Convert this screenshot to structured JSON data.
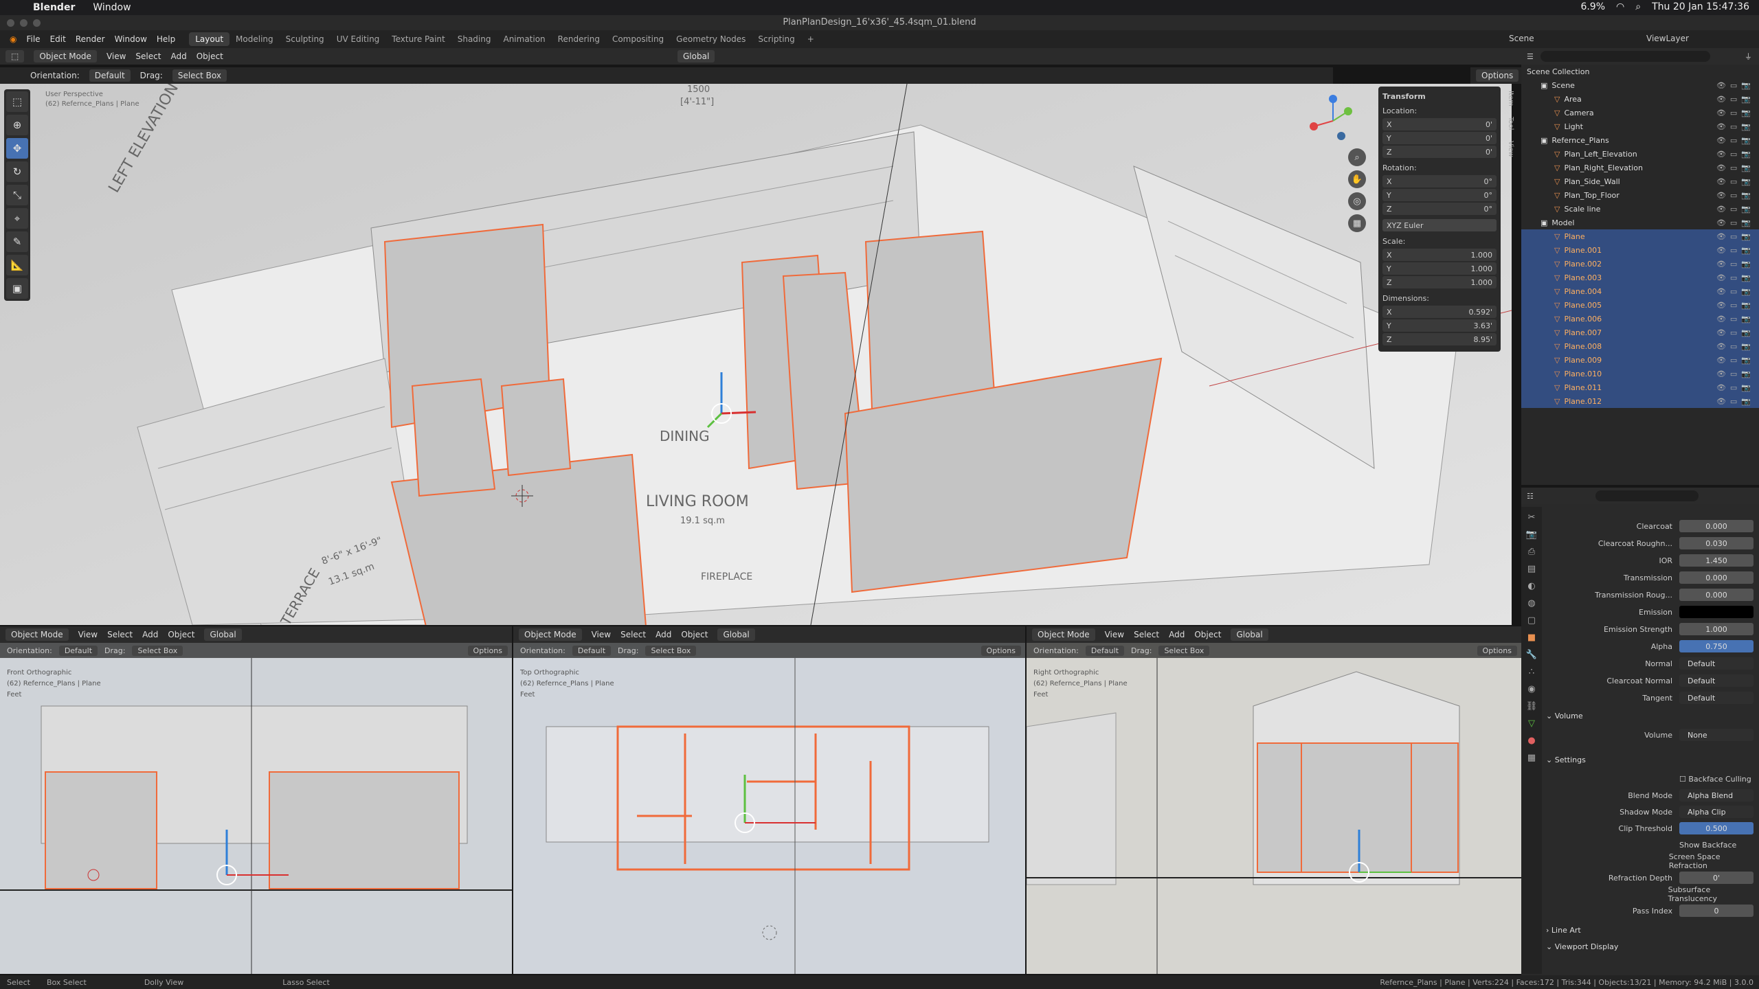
{
  "macbar": {
    "app": "Blender",
    "menu": [
      "Window"
    ],
    "battery": "6.9%",
    "datetime": "Thu 20 Jan  15:47:36"
  },
  "window": {
    "title": "PlanPlanDesign_16'x36'_45.4sqm_01.blend"
  },
  "menus": [
    "File",
    "Edit",
    "Render",
    "Window",
    "Help"
  ],
  "workspaces": [
    "Layout",
    "Modeling",
    "Sculpting",
    "UV Editing",
    "Texture Paint",
    "Shading",
    "Animation",
    "Rendering",
    "Compositing",
    "Geometry Nodes",
    "Scripting"
  ],
  "scene": {
    "name": "Scene",
    "view_layer": "ViewLayer"
  },
  "header": {
    "mode": "Object Mode",
    "view": "View",
    "select": "Select",
    "add": "Add",
    "object": "Object",
    "transform": "Global",
    "orientation_label": "Orientation:",
    "orientation": "Default",
    "drag_label": "Drag:",
    "drag": "Select Box",
    "options": "Options"
  },
  "viewport_main": {
    "view_name": "User Perspective",
    "collection": "(62) Refernce_Plans | Plane"
  },
  "drawing_labels": {
    "dining": "DINING",
    "living": "LIVING ROOM",
    "living_sub": "19.1 sq.m",
    "fireplace": "FIREPLACE",
    "terrace": "TERRACE",
    "terrace_dim": "8'-6\" x 16'-9\"",
    "terrace_area": "13.1 sq.m",
    "dim_top": "1500",
    "dim_top_imp": "[4'-11\"]",
    "elevation": "LEFT ELEVATION"
  },
  "transform": {
    "title": "Transform",
    "location_label": "Location:",
    "rotation_label": "Rotation:",
    "scale_label": "Scale:",
    "dimensions_label": "Dimensions:",
    "euler": "XYZ Euler",
    "location": [
      {
        "axis": "X",
        "value": "0'"
      },
      {
        "axis": "Y",
        "value": "0'"
      },
      {
        "axis": "Z",
        "value": "0'"
      }
    ],
    "rotation": [
      {
        "axis": "X",
        "value": "0°"
      },
      {
        "axis": "Y",
        "value": "0°"
      },
      {
        "axis": "Z",
        "value": "0°"
      }
    ],
    "scale": [
      {
        "axis": "X",
        "value": "1.000"
      },
      {
        "axis": "Y",
        "value": "1.000"
      },
      {
        "axis": "Z",
        "value": "1.000"
      }
    ],
    "dimensions": [
      {
        "axis": "X",
        "value": "0.592'"
      },
      {
        "axis": "Y",
        "value": "3.63'"
      },
      {
        "axis": "Z",
        "value": "8.95'"
      }
    ]
  },
  "side_tabs": [
    "Item",
    "Tool",
    "View"
  ],
  "bottom_views": [
    {
      "view_name": "Front Orthographic",
      "collection": "(62) Refernce_Plans | Plane",
      "units": "Feet"
    },
    {
      "view_name": "Top Orthographic",
      "collection": "(62) Refernce_Plans | Plane",
      "units": "Feet"
    },
    {
      "view_name": "Right Orthographic",
      "collection": "(62) Refernce_Plans | Plane",
      "units": "Feet"
    }
  ],
  "outliner": {
    "root": "Scene Collection",
    "items": [
      {
        "name": "Scene",
        "indent": 1,
        "sel": false
      },
      {
        "name": "Area",
        "indent": 2,
        "sel": false
      },
      {
        "name": "Camera",
        "indent": 2,
        "sel": false
      },
      {
        "name": "Light",
        "indent": 2,
        "sel": false
      },
      {
        "name": "Refernce_Plans",
        "indent": 1,
        "sel": false
      },
      {
        "name": "Plan_Left_Elevation",
        "indent": 2,
        "sel": false
      },
      {
        "name": "Plan_Right_Elevation",
        "indent": 2,
        "sel": false
      },
      {
        "name": "Plan_Side_Wall",
        "indent": 2,
        "sel": false
      },
      {
        "name": "Plan_Top_Floor",
        "indent": 2,
        "sel": false
      },
      {
        "name": "Scale line",
        "indent": 2,
        "sel": false
      },
      {
        "name": "Model",
        "indent": 1,
        "sel": false
      },
      {
        "name": "Plane",
        "indent": 2,
        "sel": true
      },
      {
        "name": "Plane.001",
        "indent": 2,
        "sel": true
      },
      {
        "name": "Plane.002",
        "indent": 2,
        "sel": true
      },
      {
        "name": "Plane.003",
        "indent": 2,
        "sel": true
      },
      {
        "name": "Plane.004",
        "indent": 2,
        "sel": true
      },
      {
        "name": "Plane.005",
        "indent": 2,
        "sel": true
      },
      {
        "name": "Plane.006",
        "indent": 2,
        "sel": true
      },
      {
        "name": "Plane.007",
        "indent": 2,
        "sel": true
      },
      {
        "name": "Plane.008",
        "indent": 2,
        "sel": true
      },
      {
        "name": "Plane.009",
        "indent": 2,
        "sel": true
      },
      {
        "name": "Plane.010",
        "indent": 2,
        "sel": true
      },
      {
        "name": "Plane.011",
        "indent": 2,
        "sel": true
      },
      {
        "name": "Plane.012",
        "indent": 2,
        "sel": true
      }
    ]
  },
  "properties": {
    "rows": [
      {
        "label": "Clearcoat",
        "value": "0.000",
        "style": ""
      },
      {
        "label": "Clearcoat Roughn...",
        "value": "0.030",
        "style": ""
      },
      {
        "label": "IOR",
        "value": "1.450",
        "style": ""
      },
      {
        "label": "Transmission",
        "value": "0.000",
        "style": ""
      },
      {
        "label": "Transmission Roug...",
        "value": "0.000",
        "style": ""
      },
      {
        "label": "Emission",
        "value": "",
        "style": "black"
      },
      {
        "label": "Emission Strength",
        "value": "1.000",
        "style": ""
      },
      {
        "label": "Alpha",
        "value": "0.750",
        "style": "blue"
      },
      {
        "label": "Normal",
        "value": "Default",
        "style": "left"
      },
      {
        "label": "Clearcoat Normal",
        "value": "Default",
        "style": "left"
      },
      {
        "label": "Tangent",
        "value": "Default",
        "style": "left"
      }
    ],
    "volume_section": "Volume",
    "volume_label": "Volume",
    "volume_value": "None",
    "settings_section": "Settings",
    "backface_culling": "Backface Culling",
    "blend_mode_label": "Blend Mode",
    "blend_mode": "Alpha Blend",
    "shadow_mode_label": "Shadow Mode",
    "shadow_mode": "Alpha Clip",
    "clip_threshold_label": "Clip Threshold",
    "clip_threshold": "0.500",
    "show_backface": "Show Backface",
    "screen_space_refraction": "Screen Space Refraction",
    "refraction_depth_label": "Refraction Depth",
    "refraction_depth": "0'",
    "subsurface_translucency": "Subsurface Translucency",
    "pass_index_label": "Pass Index",
    "pass_index": "0",
    "line_art": "Line Art",
    "viewport_display": "Viewport Display"
  },
  "status": {
    "select": "Select",
    "box_select": "Box Select",
    "dolly": "Dolly View",
    "lasso": "Lasso Select",
    "stats": "Refernce_Plans | Plane | Verts:224 | Faces:172 | Tris:344 | Objects:13/21 | Memory: 94.2 MiB | 3.0.0"
  },
  "colors": {
    "accent": "#4772b3",
    "selection_outline": "#f06a3a",
    "active_name": "#ffb060"
  }
}
